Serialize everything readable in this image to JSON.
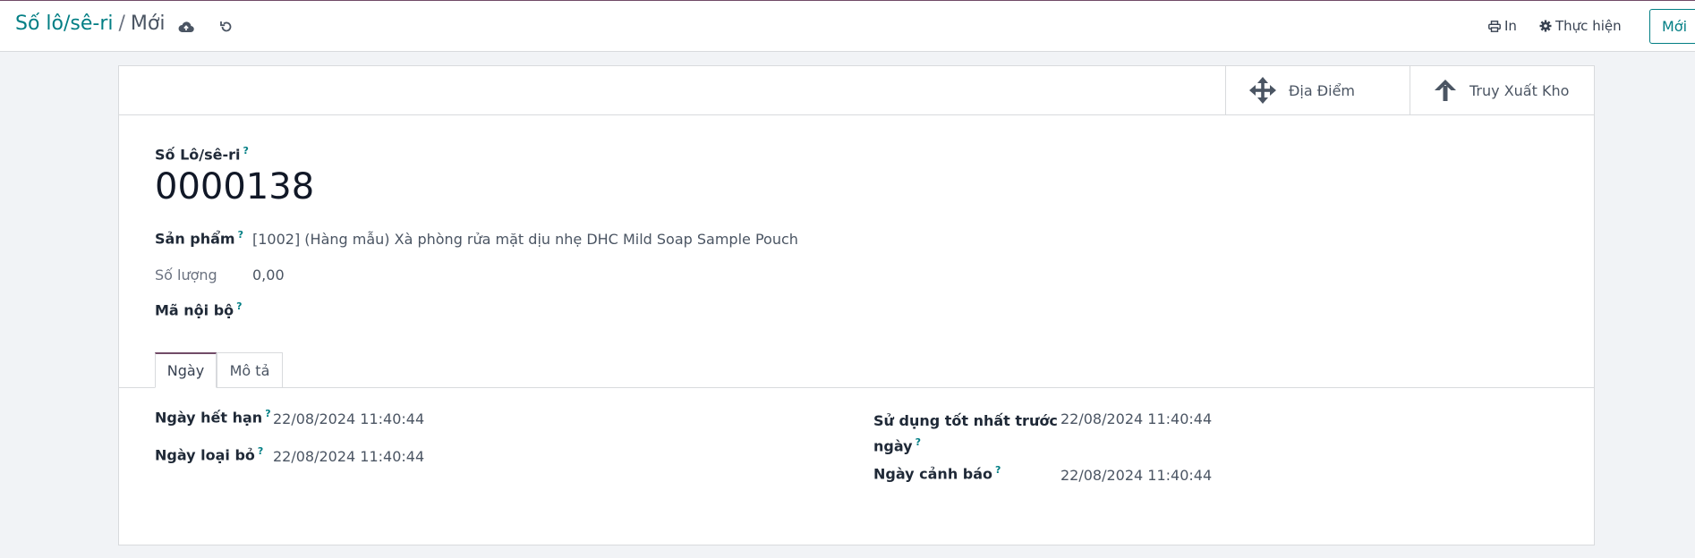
{
  "breadcrumb": {
    "parent": "Số lô/sê-ri",
    "separator": "/",
    "current": "Mới"
  },
  "toolbar": {
    "print_label": "In",
    "action_label": "Thực hiện",
    "new_label": "Mới"
  },
  "smart_buttons": {
    "locations_label": "Địa Điểm",
    "traceability_label": "Truy Xuất Kho"
  },
  "form": {
    "lot_label": "Số Lô/sê-ri",
    "lot_value": "0000138",
    "product_label": "Sản phẩm",
    "product_value": "[1002] (Hàng mẫu) Xà phòng rửa mặt dịu nhẹ DHC Mild Soap Sample Pouch",
    "quantity_label": "Số lượng",
    "quantity_value": "0,00",
    "ref_label": "Mã nội bộ",
    "help_mark": "?"
  },
  "tabs": [
    {
      "label": "Ngày",
      "active": true
    },
    {
      "label": "Mô tả",
      "active": false
    }
  ],
  "dates": {
    "expiration_label": "Ngày hết hạn",
    "expiration_value": "22/08/2024 11:40:44",
    "removal_label": "Ngày loại bỏ",
    "removal_value": "22/08/2024 11:40:44",
    "use_label_line1": "Sử dụng tốt nhất trước",
    "use_label_line2": "ngày",
    "use_value": "22/08/2024 11:40:44",
    "alert_label": "Ngày cảnh báo",
    "alert_value": "22/08/2024 11:40:44"
  },
  "colors": {
    "accent": "#017e84",
    "brand": "#714b67"
  },
  "icons": [
    "cloud-upload-icon",
    "discard-icon",
    "print-icon",
    "gear-icon",
    "arrows-move-icon",
    "arrow-up-icon"
  ]
}
